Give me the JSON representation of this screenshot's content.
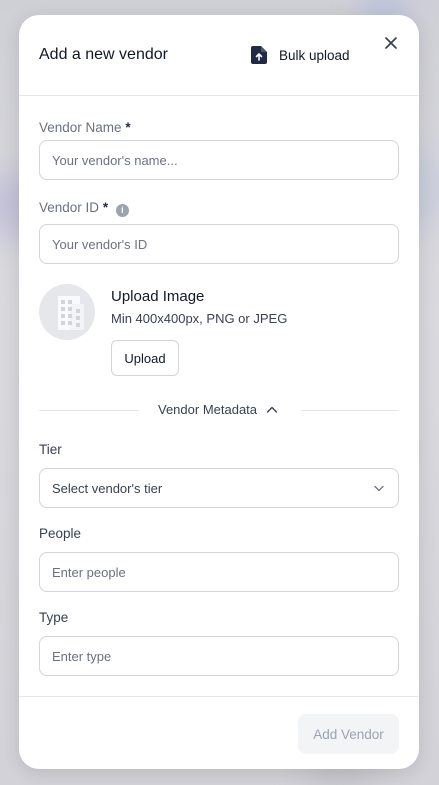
{
  "modal": {
    "title": "Add a new vendor",
    "bulk_upload_label": "Bulk upload"
  },
  "form": {
    "vendor_name": {
      "label": "Vendor Name",
      "required_mark": "*",
      "placeholder": "Your vendor's name...",
      "value": ""
    },
    "vendor_id": {
      "label": "Vendor ID",
      "required_mark": "*",
      "placeholder": "Your vendor's ID",
      "value": ""
    },
    "image": {
      "title": "Upload Image",
      "subtitle": "Min 400x400px, PNG or JPEG",
      "button_label": "Upload"
    },
    "metadata": {
      "label": "Vendor Metadata",
      "expanded": true
    },
    "tier": {
      "label": "Tier",
      "selected": "Select vendor's tier"
    },
    "people": {
      "label": "People",
      "placeholder": "Enter people",
      "value": ""
    },
    "type": {
      "label": "Type",
      "placeholder": "Enter type",
      "value": ""
    }
  },
  "footer": {
    "submit_label": "Add Vendor",
    "submit_enabled": false
  },
  "colors": {
    "accent_dark": "#1f2a44",
    "border": "#d1d5db",
    "disabled_bg": "#f3f4f6",
    "disabled_text": "#9ca3af"
  },
  "icons": {
    "bulk_upload": "file-upload-icon",
    "close": "close-icon",
    "info": "info-icon",
    "avatar": "building-icon",
    "toggle": "chevron-up-icon",
    "select": "chevron-down-icon"
  }
}
